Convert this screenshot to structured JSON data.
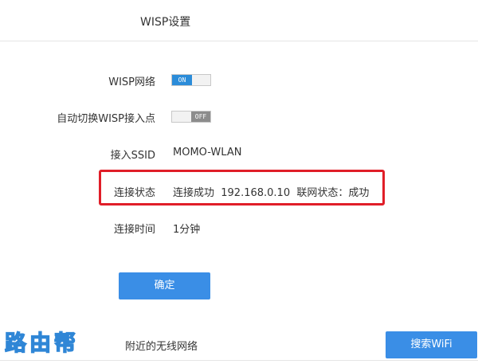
{
  "header": {
    "title": "WISP设置"
  },
  "form": {
    "wisp_network": {
      "label": "WISP网络",
      "toggle_text": "ON",
      "state": "on"
    },
    "auto_switch": {
      "label": "自动切换WISP接入点",
      "toggle_text": "OFF",
      "state": "off"
    },
    "ssid": {
      "label": "接入SSID",
      "value": "MOMO-WLAN"
    },
    "connection_status": {
      "label": "连接状态",
      "value": "连接成功  192.168.0.10  联网状态：成功"
    },
    "connection_time": {
      "label": "连接时间",
      "value": "1分钟"
    },
    "confirm_label": "确定"
  },
  "nearby": {
    "label": "附近的无线网络",
    "search_label": "搜索WiFi"
  },
  "watermark": {
    "text": "路由帮"
  },
  "colors": {
    "accent": "#3a8ee6",
    "toggle_on": "#2b8cd9",
    "toggle_off": "#8c8c8c",
    "highlight": "#e01e28"
  }
}
